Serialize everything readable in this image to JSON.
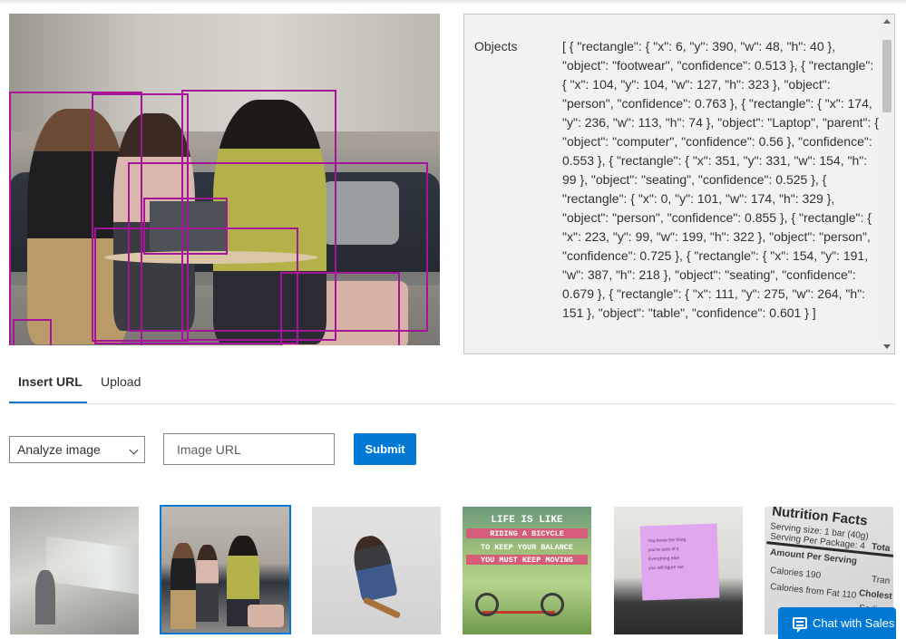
{
  "objects_panel": {
    "label": "Objects",
    "json_text": "[ { \"rectangle\": { \"x\": 6, \"y\": 390, \"w\": 48, \"h\": 40 }, \"object\": \"footwear\", \"confidence\": 0.513 }, { \"rectangle\": { \"x\": 104, \"y\": 104, \"w\": 127, \"h\": 323 }, \"object\": \"person\", \"confidence\": 0.763 }, { \"rectangle\": { \"x\": 174, \"y\": 236, \"w\": 113, \"h\": 74 }, \"object\": \"Laptop\", \"parent\": { \"object\": \"computer\", \"confidence\": 0.56 }, \"confidence\": 0.553 }, { \"rectangle\": { \"x\": 351, \"y\": 331, \"w\": 154, \"h\": 99 }, \"object\": \"seating\", \"confidence\": 0.525 }, { \"rectangle\": { \"x\": 0, \"y\": 101, \"w\": 174, \"h\": 329 }, \"object\": \"person\", \"confidence\": 0.855 }, { \"rectangle\": { \"x\": 223, \"y\": 99, \"w\": 199, \"h\": 322 }, \"object\": \"person\", \"confidence\": 0.725 }, { \"rectangle\": { \"x\": 154, \"y\": 191, \"w\": 387, \"h\": 218 }, \"object\": \"seating\", \"confidence\": 0.679 }, { \"rectangle\": { \"x\": 111, \"y\": 275, \"w\": 264, \"h\": 151 }, \"object\": \"table\", \"confidence\": 0.601 } ]"
  },
  "tabs": [
    {
      "label": "Insert URL",
      "active": true
    },
    {
      "label": "Upload",
      "active": false
    }
  ],
  "form": {
    "mode_select": "Analyze image",
    "url_placeholder": "Image URL",
    "submit_label": "Submit"
  },
  "thumbnails": {
    "t4_lines": [
      "LIFE IS LIKE",
      "RIDING A BICYCLE",
      "TO KEEP YOUR BALANCE",
      "YOU MUST KEEP MOVING"
    ],
    "t5_note_lines": [
      "You know the thing",
      "you're sure of it",
      "Everything else",
      "you will figure out"
    ],
    "t6_title": "Nutrition Facts",
    "t6_lines": [
      "Serving size: 1 bar (40g)",
      "Serving Per Package: 4",
      "Amount Per Serving",
      "Calories 190",
      "Calories from Fat 110",
      "Tota",
      "Tran",
      "Cholest",
      "Sodiu"
    ]
  },
  "chat": {
    "label": "Chat with Sales"
  },
  "colors": {
    "accent": "#0078d4",
    "bbox": "#a6149a"
  }
}
